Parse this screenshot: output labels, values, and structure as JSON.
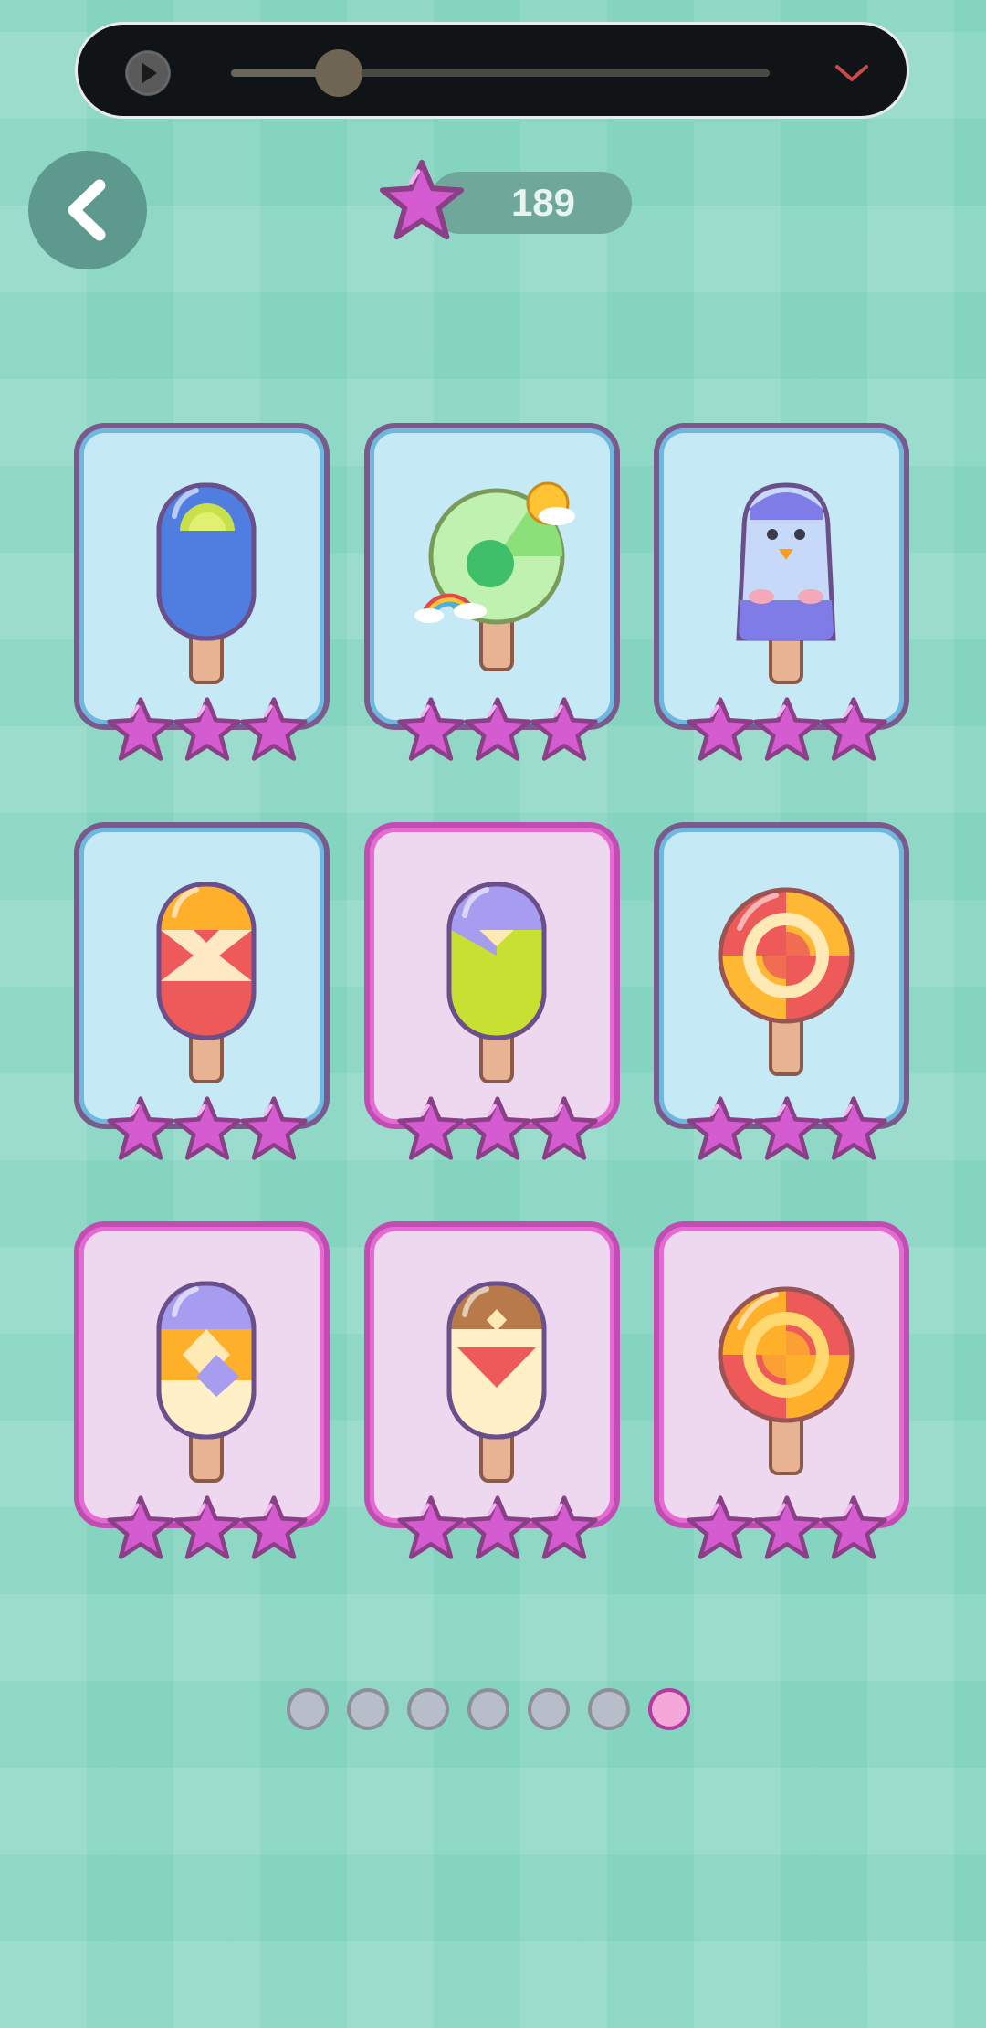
{
  "media_bar": {
    "progress": 0.2,
    "controls": [
      "play-icon",
      "chevron-down-icon"
    ]
  },
  "header": {
    "back_icon": "chevron-left-icon",
    "star_icon": "star-icon",
    "score": "189"
  },
  "levels": [
    {
      "id": 1,
      "theme": "blue",
      "treat": "popsicle-blue-stars",
      "stars_earned": 3,
      "stars_total": 3
    },
    {
      "id": 2,
      "theme": "blue",
      "treat": "lollipop-green-sun-rainbow",
      "stars_earned": 3,
      "stars_total": 3
    },
    {
      "id": 3,
      "theme": "blue",
      "treat": "popsicle-penguin",
      "stars_earned": 3,
      "stars_total": 3
    },
    {
      "id": 4,
      "theme": "blue",
      "treat": "popsicle-red-orange-triangles",
      "stars_earned": 3,
      "stars_total": 3
    },
    {
      "id": 5,
      "theme": "pink",
      "treat": "popsicle-purple-lime",
      "stars_earned": 3,
      "stars_total": 3
    },
    {
      "id": 6,
      "theme": "blue",
      "treat": "lollipop-red-swirl",
      "stars_earned": 3,
      "stars_total": 3
    },
    {
      "id": 7,
      "theme": "pink",
      "treat": "popsicle-purple-orange-cream",
      "stars_earned": 3,
      "stars_total": 3
    },
    {
      "id": 8,
      "theme": "pink",
      "treat": "popsicle-chocolate-heart",
      "stars_earned": 3,
      "stars_total": 3
    },
    {
      "id": 9,
      "theme": "pink",
      "treat": "lollipop-orange-swirl",
      "stars_earned": 3,
      "stars_total": 3
    }
  ],
  "pagination": {
    "pages": 7,
    "current": 7
  },
  "colors": {
    "background": "#84d4c0",
    "star": "#d55bd0",
    "card_blue": "#c6e9f6",
    "card_pink": "#eed8ef",
    "dot_active": "#f4a7d8"
  }
}
